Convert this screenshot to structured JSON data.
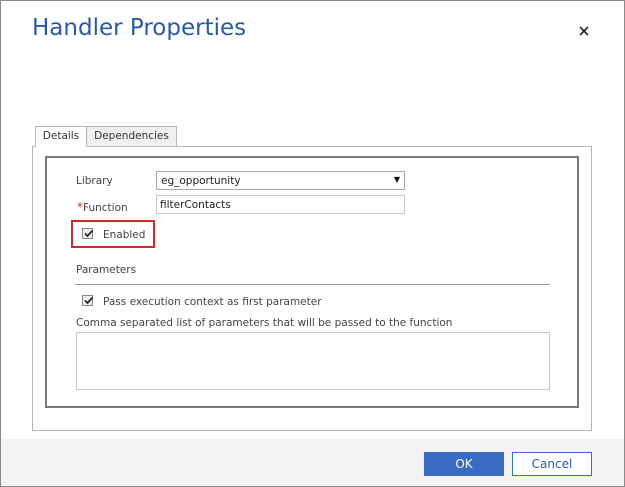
{
  "dialog": {
    "title": "Handler Properties"
  },
  "tabs": [
    {
      "label": "Details",
      "active": true
    },
    {
      "label": "Dependencies",
      "active": false
    }
  ],
  "form": {
    "library_label": "Library",
    "library_value": "eg_opportunity",
    "function_required_marker": "*",
    "function_label": "Function",
    "function_value": "filterContacts",
    "enabled_label": "Enabled",
    "enabled_checked": true,
    "parameters_heading": "Parameters",
    "pass_context_label": "Pass execution context as first parameter",
    "pass_context_checked": true,
    "params_list_label": "Comma separated list of parameters that will be passed to the function",
    "params_list_value": ""
  },
  "footer": {
    "ok_label": "OK",
    "cancel_label": "Cancel"
  },
  "icons": {
    "close": "close-icon",
    "dropdown": "chevron-down-icon",
    "check": "check-icon"
  },
  "colors": {
    "title": "#2a5aa4",
    "primary_button": "#3a6cc5",
    "highlight": "#d9262d",
    "required": "#c0392b"
  }
}
